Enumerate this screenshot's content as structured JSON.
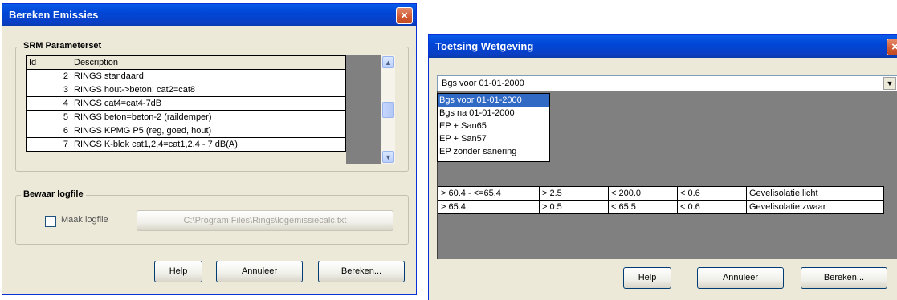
{
  "emissies": {
    "title": "Bereken Emissies",
    "close": "×",
    "srm": {
      "group_label": "SRM Parameterset",
      "columns": [
        "Id",
        "Description"
      ],
      "rows": [
        {
          "id": "2",
          "desc": "RINGS standaard"
        },
        {
          "id": "3",
          "desc": "RINGS hout->beton; cat2=cat8"
        },
        {
          "id": "4",
          "desc": "RINGS cat4=cat4-7dB"
        },
        {
          "id": "5",
          "desc": "RINGS beton=beton-2 (raildemper)"
        },
        {
          "id": "6",
          "desc": "RINGS KPMG P5 (reg, goed, hout)"
        },
        {
          "id": "7",
          "desc": "RINGS K-blok cat1,2,4=cat1,2,4 - 7 dB(A)"
        }
      ]
    },
    "log": {
      "group_label": "Bewaar logfile",
      "checkbox_label": "Maak logfile",
      "path": "C:\\Program Files\\Rings\\logemissiecalc.txt"
    },
    "buttons": {
      "help": "Help",
      "cancel": "Annuleer",
      "ok": "Bereken..."
    }
  },
  "toetsing": {
    "title": "Toetsing Wetgeving",
    "close": "×",
    "combo": {
      "value": "Bgs voor 01-01-2000",
      "arrow": "▼",
      "options": [
        "Bgs voor 01-01-2000",
        "Bgs na 01-01-2000",
        "EP + San65",
        "EP + San57",
        "EP zonder sanering"
      ],
      "selected_index": 0
    },
    "grid_rows": [
      [
        "> 60.4 - <=65.4",
        "> 2.5",
        "< 200.0",
        "< 0.6",
        "Gevelisolatie licht"
      ],
      [
        "> 65.4",
        "> 0.5",
        "< 65.5",
        "< 0.6",
        "Gevelisolatie zwaar"
      ]
    ],
    "buttons": {
      "help": "Help",
      "cancel": "Annuleer",
      "ok": "Bereken..."
    }
  }
}
